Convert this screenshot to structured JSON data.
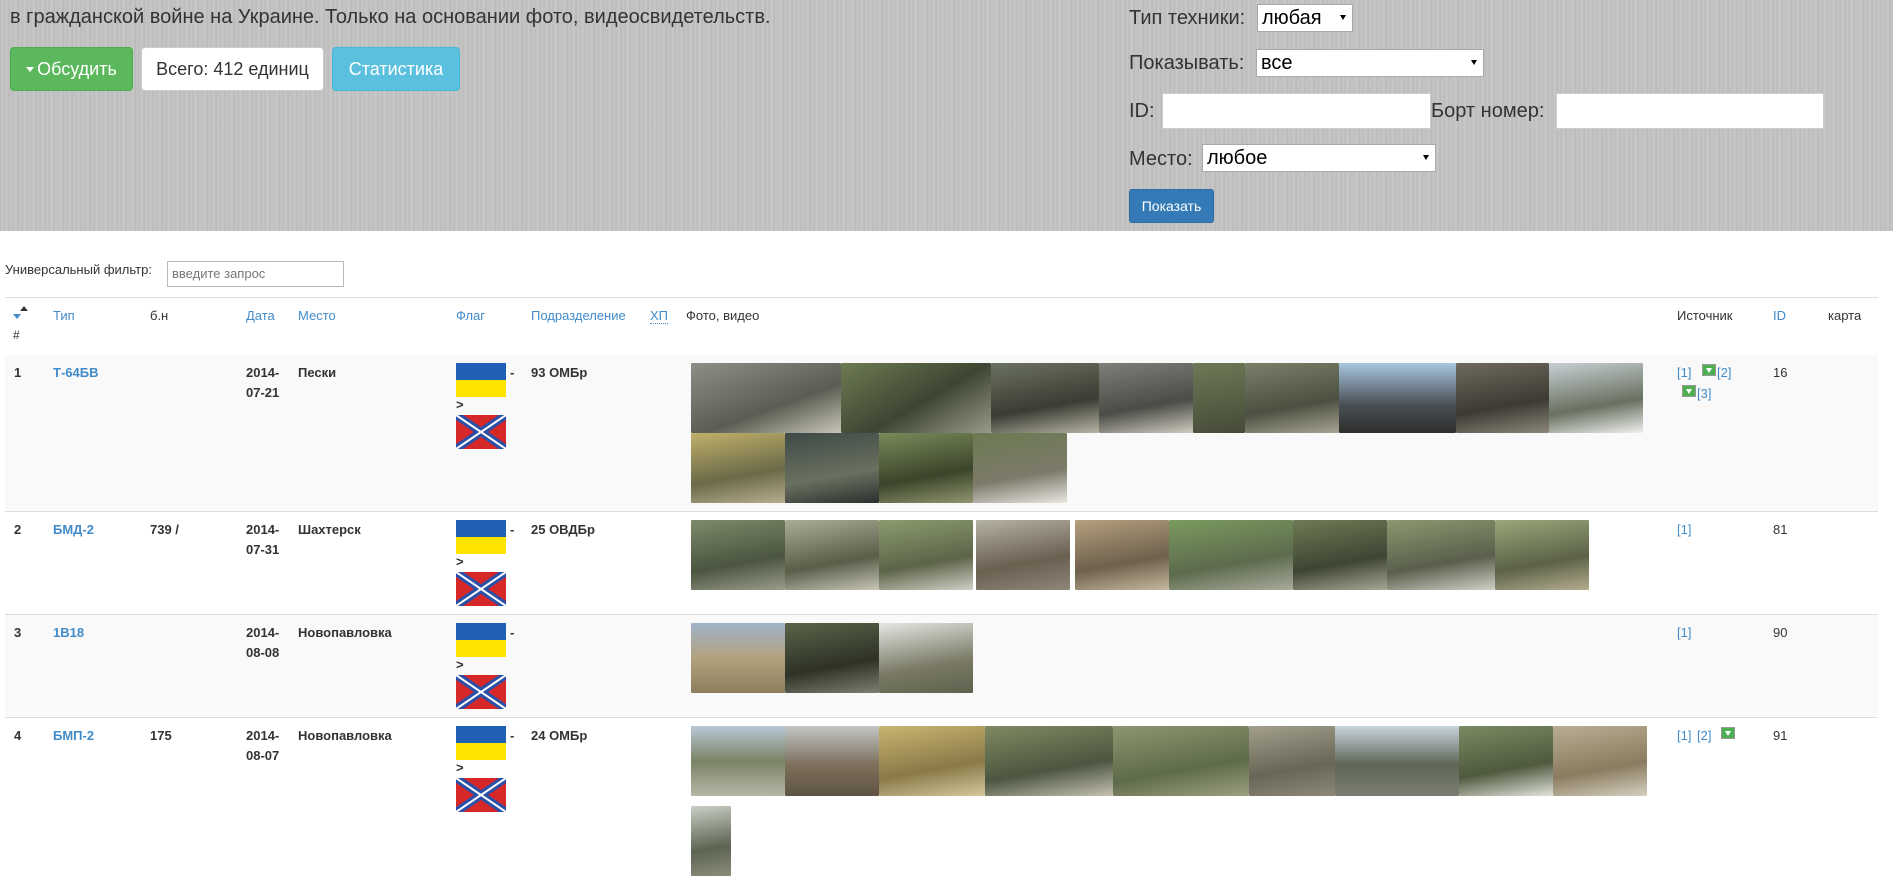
{
  "header": {
    "intro_text": "в гражданской войне на Украине. Только на основании фото, видеосвидетельств.",
    "discuss_button": "Обсудить",
    "total_button": "Всего: 412 единиц",
    "stats_button": "Статистика"
  },
  "filters": {
    "type_label": "Тип техники:",
    "type_value": "любая",
    "show_label": "Показывать:",
    "show_value": "все",
    "id_label": "ID:",
    "id_value": "",
    "board_label": "Борт номер:",
    "board_value": "",
    "place_label": "Место:",
    "place_value": "любое",
    "show_button": "Показать"
  },
  "universal_filter": {
    "label": "Универсальный фильтр:",
    "placeholder": "введите запрос"
  },
  "table": {
    "columns": {
      "num": "#",
      "type": "Тип",
      "board": "б.н",
      "date": "Дата",
      "place": "Место",
      "flag": "Флаг",
      "unit": "Подразделение",
      "hp": "ХП",
      "photo": "Фото, видео",
      "source": "Источник",
      "id": "ID",
      "map": "карта"
    },
    "rows": [
      {
        "num": "1",
        "type": "Т-64БВ",
        "board": "",
        "date": "2014-07-21",
        "place": "Пески",
        "unit": "93 ОМБр",
        "source1": "[1]",
        "source2": "[2]",
        "source3": "[3]",
        "id": "16"
      },
      {
        "num": "2",
        "type": "БМД-2",
        "board": "739 /",
        "date": "2014-07-31",
        "place": "Шахтерск",
        "unit": "25 ОВДБр",
        "source1": "[1]",
        "id": "81"
      },
      {
        "num": "3",
        "type": "1В18",
        "board": "",
        "date": "2014-08-08",
        "place": "Новопавловка",
        "unit": "",
        "source1": "[1]",
        "id": "90"
      },
      {
        "num": "4",
        "type": "БМП-2",
        "board": "175",
        "date": "2014-08-07",
        "place": "Новопавловка",
        "unit": "24 ОМБр",
        "source1": "[1]",
        "source2": "[2]",
        "id": "91"
      }
    ],
    "flag_separator": "-",
    "flag_arrow": ">"
  }
}
